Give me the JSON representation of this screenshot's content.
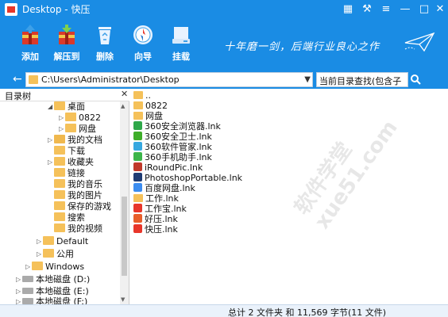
{
  "titlebar": {
    "title": "Desktop - 快压"
  },
  "toolbar": {
    "add_label": "添加",
    "extract_label": "解压到",
    "delete_label": "删除",
    "wizard_label": "向导",
    "mount_label": "挂载",
    "slogan": "十年磨一剑，后端行业良心之作"
  },
  "address": {
    "path": "C:\\Users\\Administrator\\Desktop",
    "search_placeholder": "当前目录查找(包含子目录)"
  },
  "tree": {
    "title": "目录树",
    "items": [
      {
        "label": "桌面"
      },
      {
        "label": "0822"
      },
      {
        "label": "网盘"
      },
      {
        "label": "我的文档"
      },
      {
        "label": "下载"
      },
      {
        "label": "收藏夹"
      },
      {
        "label": "链接"
      },
      {
        "label": "我的音乐"
      },
      {
        "label": "我的图片"
      },
      {
        "label": "保存的游戏"
      },
      {
        "label": "搜索"
      },
      {
        "label": "我的视频"
      },
      {
        "label": "Default"
      },
      {
        "label": "公用"
      },
      {
        "label": "Windows"
      },
      {
        "label": "本地磁盘 (D:)"
      },
      {
        "label": "本地磁盘 (E:)"
      },
      {
        "label": "本地磁盘 (F:)"
      }
    ]
  },
  "files": [
    {
      "name": "..",
      "icon": "folder-icon",
      "color": "#f5c15a"
    },
    {
      "name": "0822",
      "icon": "folder-icon",
      "color": "#f5c15a"
    },
    {
      "name": "网盘",
      "icon": "folder-icon",
      "color": "#f5c15a"
    },
    {
      "name": "360安全浏览器.lnk",
      "icon": "360-browser-icon",
      "color": "#2fa84a"
    },
    {
      "name": "360安全卫士.lnk",
      "icon": "360-safe-icon",
      "color": "#3fae2a"
    },
    {
      "name": "360软件管家.lnk",
      "icon": "360-software-icon",
      "color": "#36a8e0"
    },
    {
      "name": "360手机助手.lnk",
      "icon": "360-mobile-icon",
      "color": "#3cb54a"
    },
    {
      "name": "iRoundPic.lnk",
      "icon": "iroundpic-icon",
      "color": "#c0392b"
    },
    {
      "name": "PhotoshopPortable.lnk",
      "icon": "photoshop-icon",
      "color": "#1f3b73"
    },
    {
      "name": "百度网盘.lnk",
      "icon": "baidu-netdisk-icon",
      "color": "#3b8cf0"
    },
    {
      "name": "工作.lnk",
      "icon": "folder-icon",
      "color": "#f5c15a"
    },
    {
      "name": "工作宝.lnk",
      "icon": "gongzuobao-icon",
      "color": "#e8362a"
    },
    {
      "name": "好压.lnk",
      "icon": "haozip-icon",
      "color": "#e85e2a"
    },
    {
      "name": "快压.lnk",
      "icon": "kuaiya-icon",
      "color": "#e8362a"
    }
  ],
  "status": {
    "text": "总计 2 文件夹 和 11,569 字节(11 文件)"
  },
  "watermark": "软件学堂 xue51.com"
}
